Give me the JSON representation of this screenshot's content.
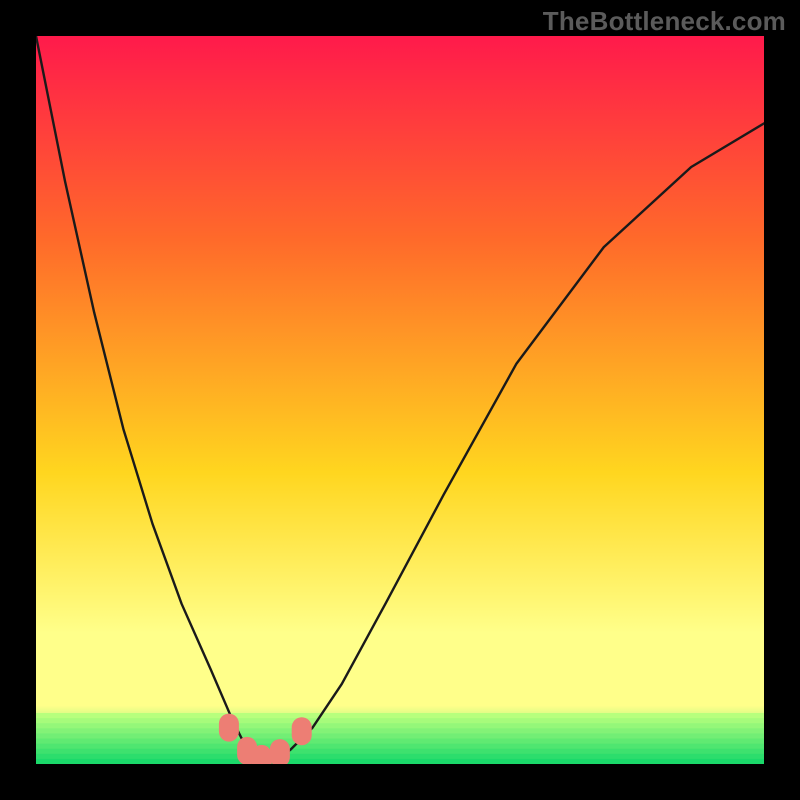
{
  "attribution": "TheBottleneck.com",
  "colors": {
    "frame": "#000000",
    "gradient_top": "#ff1a4b",
    "gradient_mid1": "#ff6a2a",
    "gradient_mid2": "#ffd61f",
    "gradient_yellowband": "#ffff8a",
    "gradient_green": "#1ee46e",
    "green_strip_top": "#b7ff7d",
    "green_strip_bottom": "#1bd96a",
    "curve": "#1a1a1a",
    "marker": "#ed7e74"
  },
  "chart_data": {
    "type": "line",
    "title": "",
    "xlabel": "",
    "ylabel": "",
    "xlim": [
      0,
      100
    ],
    "ylim": [
      0,
      100
    ],
    "annotations": [
      "TheBottleneck.com"
    ],
    "series": [
      {
        "name": "bottleneck-curve",
        "x": [
          0,
          4,
          8,
          12,
          16,
          20,
          24,
          27,
          29,
          31,
          33,
          35,
          38,
          42,
          48,
          56,
          66,
          78,
          90,
          100
        ],
        "y": [
          100,
          80,
          62,
          46,
          33,
          22,
          13,
          6,
          2,
          0.5,
          0.5,
          2,
          5,
          11,
          22,
          37,
          55,
          71,
          82,
          88
        ]
      }
    ],
    "markers": [
      {
        "x": 26.5,
        "y": 5.0
      },
      {
        "x": 29.0,
        "y": 1.8
      },
      {
        "x": 31.0,
        "y": 0.7
      },
      {
        "x": 33.5,
        "y": 1.5
      },
      {
        "x": 36.5,
        "y": 4.5
      }
    ]
  }
}
